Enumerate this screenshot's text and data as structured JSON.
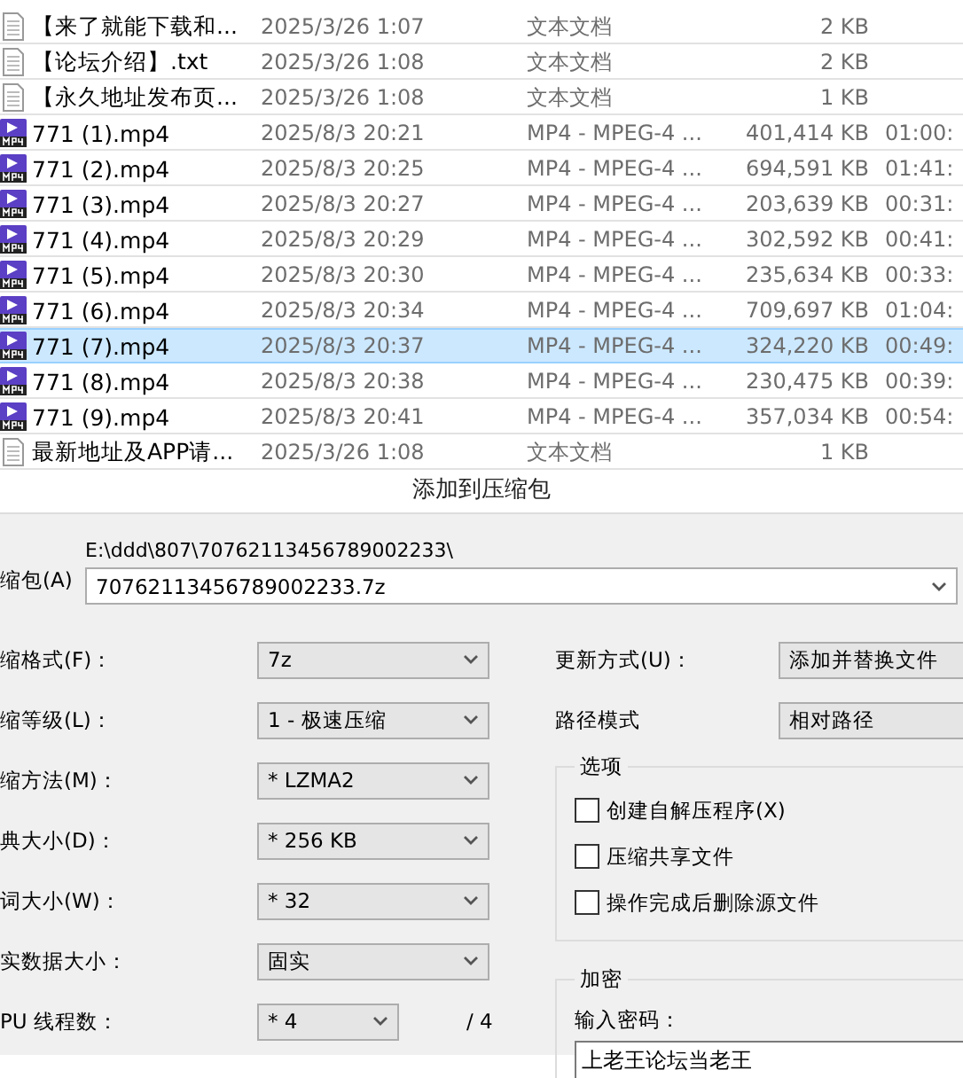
{
  "files": [
    {
      "kind": "text",
      "name": "【来了就能下载和...",
      "date": "2025/3/26 1:07",
      "type": "文本文档",
      "size": "2 KB",
      "selected": false
    },
    {
      "kind": "text",
      "name": "【论坛介绍】.txt",
      "date": "2025/3/26 1:08",
      "type": "文本文档",
      "size": "2 KB",
      "selected": false
    },
    {
      "kind": "text",
      "name": "【永久地址发布页...",
      "date": "2025/3/26 1:08",
      "type": "文本文档",
      "size": "1 KB",
      "selected": false
    },
    {
      "kind": "video",
      "name": "771 (1).mp4",
      "date": "2025/8/3 20:21",
      "type": "MP4 - MPEG-4 ...",
      "size": "401,414 KB",
      "duration": "01:00:",
      "selected": false
    },
    {
      "kind": "video",
      "name": "771 (2).mp4",
      "date": "2025/8/3 20:25",
      "type": "MP4 - MPEG-4 ...",
      "size": "694,591 KB",
      "duration": "01:41:",
      "selected": false
    },
    {
      "kind": "video",
      "name": "771 (3).mp4",
      "date": "2025/8/3 20:27",
      "type": "MP4 - MPEG-4 ...",
      "size": "203,639 KB",
      "duration": "00:31:",
      "selected": false
    },
    {
      "kind": "video",
      "name": "771 (4).mp4",
      "date": "2025/8/3 20:29",
      "type": "MP4 - MPEG-4 ...",
      "size": "302,592 KB",
      "duration": "00:41:",
      "selected": false
    },
    {
      "kind": "video",
      "name": "771 (5).mp4",
      "date": "2025/8/3 20:30",
      "type": "MP4 - MPEG-4 ...",
      "size": "235,634 KB",
      "duration": "00:33:",
      "selected": false
    },
    {
      "kind": "video",
      "name": "771 (6).mp4",
      "date": "2025/8/3 20:34",
      "type": "MP4 - MPEG-4 ...",
      "size": "709,697 KB",
      "duration": "01:04:",
      "selected": false
    },
    {
      "kind": "video",
      "name": "771 (7).mp4",
      "date": "2025/8/3 20:37",
      "type": "MP4 - MPEG-4 ...",
      "size": "324,220 KB",
      "duration": "00:49:",
      "selected": true
    },
    {
      "kind": "video",
      "name": "771 (8).mp4",
      "date": "2025/8/3 20:38",
      "type": "MP4 - MPEG-4 ...",
      "size": "230,475 KB",
      "duration": "00:39:",
      "selected": false
    },
    {
      "kind": "video",
      "name": "771 (9).mp4",
      "date": "2025/8/3 20:41",
      "type": "MP4 - MPEG-4 ...",
      "size": "357,034 KB",
      "duration": "00:54:",
      "selected": false
    },
    {
      "kind": "text",
      "name": "最新地址及APP请...",
      "date": "2025/3/26 1:08",
      "type": "文本文档",
      "size": "1 KB",
      "selected": false
    }
  ],
  "dialog": {
    "title": "添加到压缩包",
    "archive_label": "缩包(A)",
    "path": "E:\\ddd\\807\\70762113456789002233\\",
    "archive_name": "70762113456789002233.7z",
    "settings": [
      {
        "label": "缩格式(F)：",
        "value": "7z"
      },
      {
        "label": "缩等级(L)：",
        "value": "1 - 极速压缩"
      },
      {
        "label": "缩方法(M)：",
        "value": "* LZMA2"
      },
      {
        "label": "典大小(D)：",
        "value": "* 256 KB"
      },
      {
        "label": "词大小(W)：",
        "value": "* 32"
      },
      {
        "label": "实数据大小：",
        "value": "固实"
      },
      {
        "label": "PU 线程数：",
        "value": "* 4",
        "suffix": "/ 4"
      }
    ],
    "update_label": "更新方式(U)：",
    "update_value": "添加并替换文件",
    "path_mode_label": "路径模式",
    "path_mode_value": "相对路径",
    "options": {
      "title": "选项",
      "items": [
        {
          "label": "创建自解压程序(X)",
          "checked": false
        },
        {
          "label": "压缩共享文件",
          "checked": false
        },
        {
          "label": "操作完成后删除源文件",
          "checked": false
        }
      ]
    },
    "encryption": {
      "title": "加密",
      "password_label": "输入密码：",
      "password_value": "上老王论坛当老王"
    }
  }
}
